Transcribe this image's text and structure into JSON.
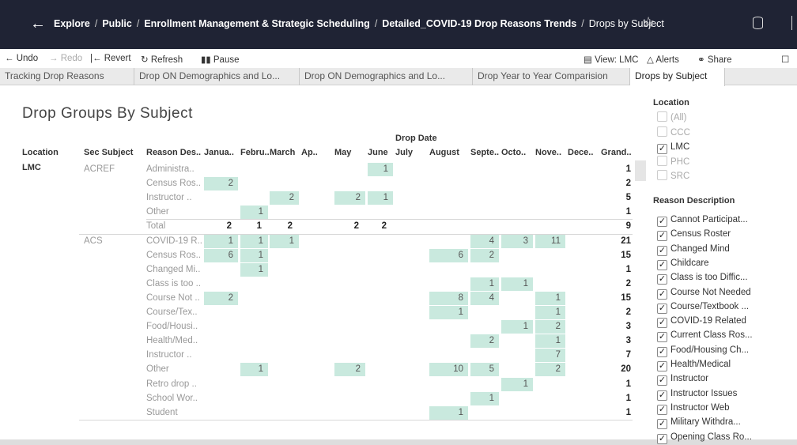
{
  "topbar": {
    "breadcrumbs": [
      "Explore",
      "Public",
      "Enrollment Management & Strategic Scheduling",
      "Detailed_COVID-19 Drop Reasons Trends"
    ],
    "current": "Drops by Subject",
    "icons": [
      "back-arrow-icon",
      "star-icon",
      "database-icon"
    ]
  },
  "toolbar": {
    "undo": "Undo",
    "redo": "Redo",
    "revert": "Revert",
    "refresh": "Refresh",
    "pause": "Pause",
    "view": "View: LMC",
    "alerts": "Alerts",
    "share": "Share"
  },
  "tabs": [
    "Tracking Drop Reasons",
    "Drop ON Demographics and Lo...",
    "Drop ON Demographics and Lo...",
    "Drop Year to Year Comparision",
    "Drops by Subject"
  ],
  "active_tab": "Drops by Subject",
  "viz": {
    "title": "Drop Groups By Subject",
    "column_group_header": "Drop Date",
    "row_headers": [
      "Location",
      "Sec Subject",
      "Reason Des.."
    ],
    "columns": [
      "Janua..",
      "Febru..",
      "March",
      "Ap..",
      "May",
      "June",
      "July",
      "August",
      "Septe..",
      "Octo..",
      "Nove..",
      "Dece..",
      "Grand.."
    ],
    "location": "LMC",
    "groups": [
      {
        "subject": "ACREF",
        "rows": [
          {
            "reason": "Administra..",
            "values": [
              "",
              "",
              "",
              "",
              "",
              "1",
              "",
              "",
              "",
              "",
              "",
              ""
            ],
            "grand": "1"
          },
          {
            "reason": "Census Ros..",
            "values": [
              "2",
              "",
              "",
              "",
              "",
              "",
              "",
              "",
              "",
              "",
              "",
              ""
            ],
            "grand": "2"
          },
          {
            "reason": "Instructor ..",
            "values": [
              "",
              "",
              "2",
              "",
              "2",
              "1",
              "",
              "",
              "",
              "",
              "",
              ""
            ],
            "grand": "5"
          },
          {
            "reason": "Other",
            "values": [
              "",
              "1",
              "",
              "",
              "",
              "",
              "",
              "",
              "",
              "",
              "",
              ""
            ],
            "grand": "1"
          },
          {
            "reason": "Total",
            "values": [
              "2",
              "1",
              "2",
              "",
              "2",
              "2",
              "",
              "",
              "",
              "",
              "",
              ""
            ],
            "grand": "9"
          }
        ]
      },
      {
        "subject": "ACS",
        "rows": [
          {
            "reason": "COVID-19 R..",
            "values": [
              "1",
              "1",
              "1",
              "",
              "",
              "",
              "",
              "",
              "4",
              "3",
              "11",
              ""
            ],
            "grand": "21"
          },
          {
            "reason": "Census Ros..",
            "values": [
              "6",
              "1",
              "",
              "",
              "",
              "",
              "",
              "6",
              "2",
              "",
              "",
              ""
            ],
            "grand": "15"
          },
          {
            "reason": "Changed Mi..",
            "values": [
              "",
              "1",
              "",
              "",
              "",
              "",
              "",
              "",
              "",
              "",
              "",
              ""
            ],
            "grand": "1"
          },
          {
            "reason": "Class is too ..",
            "values": [
              "",
              "",
              "",
              "",
              "",
              "",
              "",
              "",
              "1",
              "1",
              "",
              ""
            ],
            "grand": "2"
          },
          {
            "reason": "Course Not ..",
            "values": [
              "2",
              "",
              "",
              "",
              "",
              "",
              "",
              "8",
              "4",
              "",
              "1",
              ""
            ],
            "grand": "15"
          },
          {
            "reason": "Course/Tex..",
            "values": [
              "",
              "",
              "",
              "",
              "",
              "",
              "",
              "1",
              "",
              "",
              "1",
              ""
            ],
            "grand": "2"
          },
          {
            "reason": "Food/Housi..",
            "values": [
              "",
              "",
              "",
              "",
              "",
              "",
              "",
              "",
              "",
              "1",
              "2",
              ""
            ],
            "grand": "3"
          },
          {
            "reason": "Health/Med..",
            "values": [
              "",
              "",
              "",
              "",
              "",
              "",
              "",
              "",
              "2",
              "",
              "1",
              ""
            ],
            "grand": "3"
          },
          {
            "reason": "Instructor ..",
            "values": [
              "",
              "",
              "",
              "",
              "",
              "",
              "",
              "",
              "",
              "",
              "7",
              ""
            ],
            "grand": "7"
          },
          {
            "reason": "Other",
            "values": [
              "",
              "1",
              "",
              "",
              "2",
              "",
              "",
              "10",
              "5",
              "",
              "2",
              ""
            ],
            "grand": "20"
          },
          {
            "reason": "Retro drop ..",
            "values": [
              "",
              "",
              "",
              "",
              "",
              "",
              "",
              "",
              "",
              "1",
              "",
              ""
            ],
            "grand": "1"
          },
          {
            "reason": "School Wor..",
            "values": [
              "",
              "",
              "",
              "",
              "",
              "",
              "",
              "",
              "1",
              "",
              "",
              ""
            ],
            "grand": "1"
          },
          {
            "reason": "Student",
            "values": [
              "",
              "",
              "",
              "",
              "",
              "",
              "",
              "1",
              "",
              "",
              "",
              ""
            ],
            "grand": "1"
          }
        ]
      }
    ]
  },
  "filters": {
    "location": {
      "title": "Location",
      "options": [
        {
          "label": "(All)",
          "checked": false
        },
        {
          "label": "CCC",
          "checked": false
        },
        {
          "label": "LMC",
          "checked": true
        },
        {
          "label": "PHC",
          "checked": false
        },
        {
          "label": "SRC",
          "checked": false
        }
      ]
    },
    "reason": {
      "title": "Reason Description",
      "options": [
        {
          "label": "Cannot Participat...",
          "checked": true
        },
        {
          "label": "Census Roster",
          "checked": true
        },
        {
          "label": "Changed Mind",
          "checked": true
        },
        {
          "label": "Childcare",
          "checked": true
        },
        {
          "label": "Class is too Diffic...",
          "checked": true
        },
        {
          "label": "Course Not Needed",
          "checked": true
        },
        {
          "label": "Course/Textbook ...",
          "checked": true
        },
        {
          "label": "COVID-19 Related",
          "checked": true
        },
        {
          "label": "Current Class Ros...",
          "checked": true
        },
        {
          "label": "Food/Housing Ch...",
          "checked": true
        },
        {
          "label": "Health/Medical",
          "checked": true
        },
        {
          "label": "Instructor",
          "checked": true
        },
        {
          "label": "Instructor Issues",
          "checked": true
        },
        {
          "label": "Instructor Web",
          "checked": true
        },
        {
          "label": "Military Withdra...",
          "checked": true
        },
        {
          "label": "Opening Class Ro...",
          "checked": true
        }
      ]
    }
  },
  "colors": {
    "topbar": "#1f2334",
    "highlight": "#c9e9de",
    "tabbar": "#eaeaea"
  }
}
